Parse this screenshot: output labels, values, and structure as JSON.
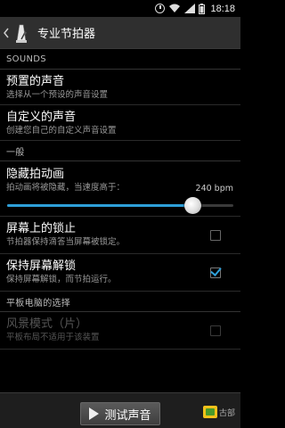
{
  "status": {
    "time": "18:18"
  },
  "actionbar": {
    "title": "专业节拍器"
  },
  "sections": {
    "sounds": "SOUNDS",
    "general": "一般",
    "tablet": "平板电脑的选择"
  },
  "items": {
    "preset": {
      "title": "预置的声音",
      "sub": "选择从一个预设的声音设置"
    },
    "custom": {
      "title": "自定义的声音",
      "sub": "创建您自己的自定义声音设置"
    },
    "hide_anim": {
      "title": "隐藏拍动画",
      "sub": "拍动画将被隐藏，当速度高于：",
      "value": "240 bpm",
      "slider_fraction": 0.82
    },
    "screen_lock": {
      "title": "屏幕上的锁止",
      "sub": "节拍器保持滴答当屏幕被锁定。",
      "checked": false
    },
    "keep_unlock": {
      "title": "保持屏幕解锁",
      "sub": "保持屏幕解锁，而节拍运行。",
      "checked": true
    },
    "landscape": {
      "title": "风景模式（片）",
      "sub": "平板布局不适用于该装置",
      "checked": false,
      "disabled": true
    }
  },
  "bottom": {
    "test_label": "测试声音",
    "watermark": "古部"
  },
  "colors": {
    "accent": "#2e9fd8",
    "actionbar": "#2f2f2f"
  }
}
